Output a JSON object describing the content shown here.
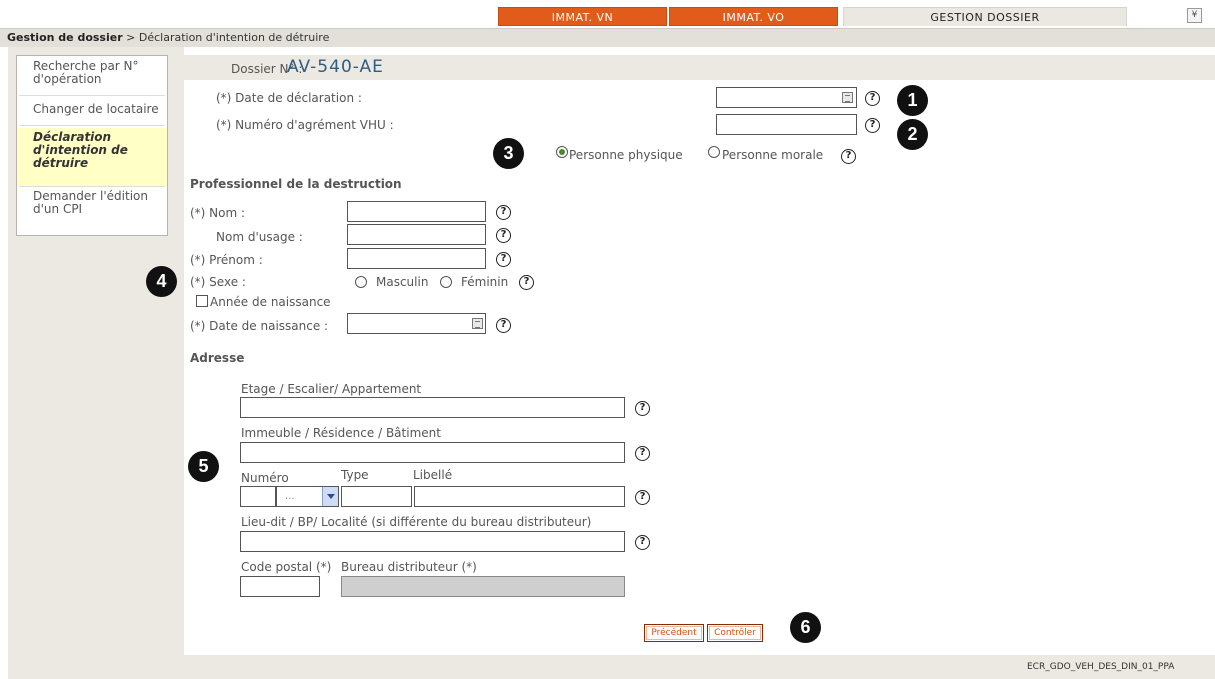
{
  "tabs": [
    {
      "label": "IMMAT. VN"
    },
    {
      "label": "IMMAT. VO"
    },
    {
      "label": "GESTION DOSSIER"
    }
  ],
  "breadcrumb": {
    "root": "Gestion de dossier",
    "separator": " > ",
    "current": "Déclaration d'intention de détruire"
  },
  "sidebar": {
    "items": [
      {
        "label": "Recherche par N° d'opération"
      },
      {
        "label": "Changer de locataire"
      },
      {
        "label": "Déclaration d'intention de détruire"
      },
      {
        "label": "Demander l'édition d'un CPI"
      }
    ]
  },
  "dossier": {
    "label": "Dossier N° :",
    "value": "AV-540-AE"
  },
  "form": {
    "date_declaration_label": "(*) Date de déclaration :",
    "agrement_label": "(*) Numéro d'agrément VHU :",
    "personne_physique": "Personne physique",
    "personne_morale": "Personne morale",
    "section_professionnel": "Professionnel de la destruction",
    "nom_label": "(*) Nom :",
    "nom_usage_label": "Nom d'usage :",
    "prenom_label": "(*) Prénom :",
    "sexe_label": "(*) Sexe :",
    "masculin": "Masculin",
    "feminin": "Féminin",
    "annee_naissance": "Année de naissance",
    "date_naissance_label": "(*) Date de naissance :",
    "section_adresse": "Adresse",
    "etage_label": "Etage / Escalier/ Appartement",
    "immeuble_label": "Immeuble / Résidence / Bâtiment",
    "numero_label": "Numéro",
    "type_label": "Type",
    "libelle_label": "Libellé",
    "select_value": "...",
    "lieudit_label": "Lieu-dit / BP/ Localité (si différente du bureau distributeur)",
    "code_postal_label": "Code postal (*)",
    "bureau_label": "Bureau distributeur (*)"
  },
  "buttons": {
    "precedent": "Précédent",
    "controler": "Contrôler"
  },
  "badges": [
    "1",
    "2",
    "3",
    "4",
    "5",
    "6"
  ],
  "help_glyph": "?",
  "footer": {
    "screen_code": "ECR_GDO_VEH_DES_DIN_01_PPA"
  },
  "colors": {
    "accent_orange": "#e15b1a",
    "title_blue": "#2e5c82",
    "selected_item": "#ffffc6"
  },
  "icons": {
    "help": "question-circle-icon",
    "calendar": "calendar-icon",
    "collapse": "chevron-double-down-icon"
  }
}
